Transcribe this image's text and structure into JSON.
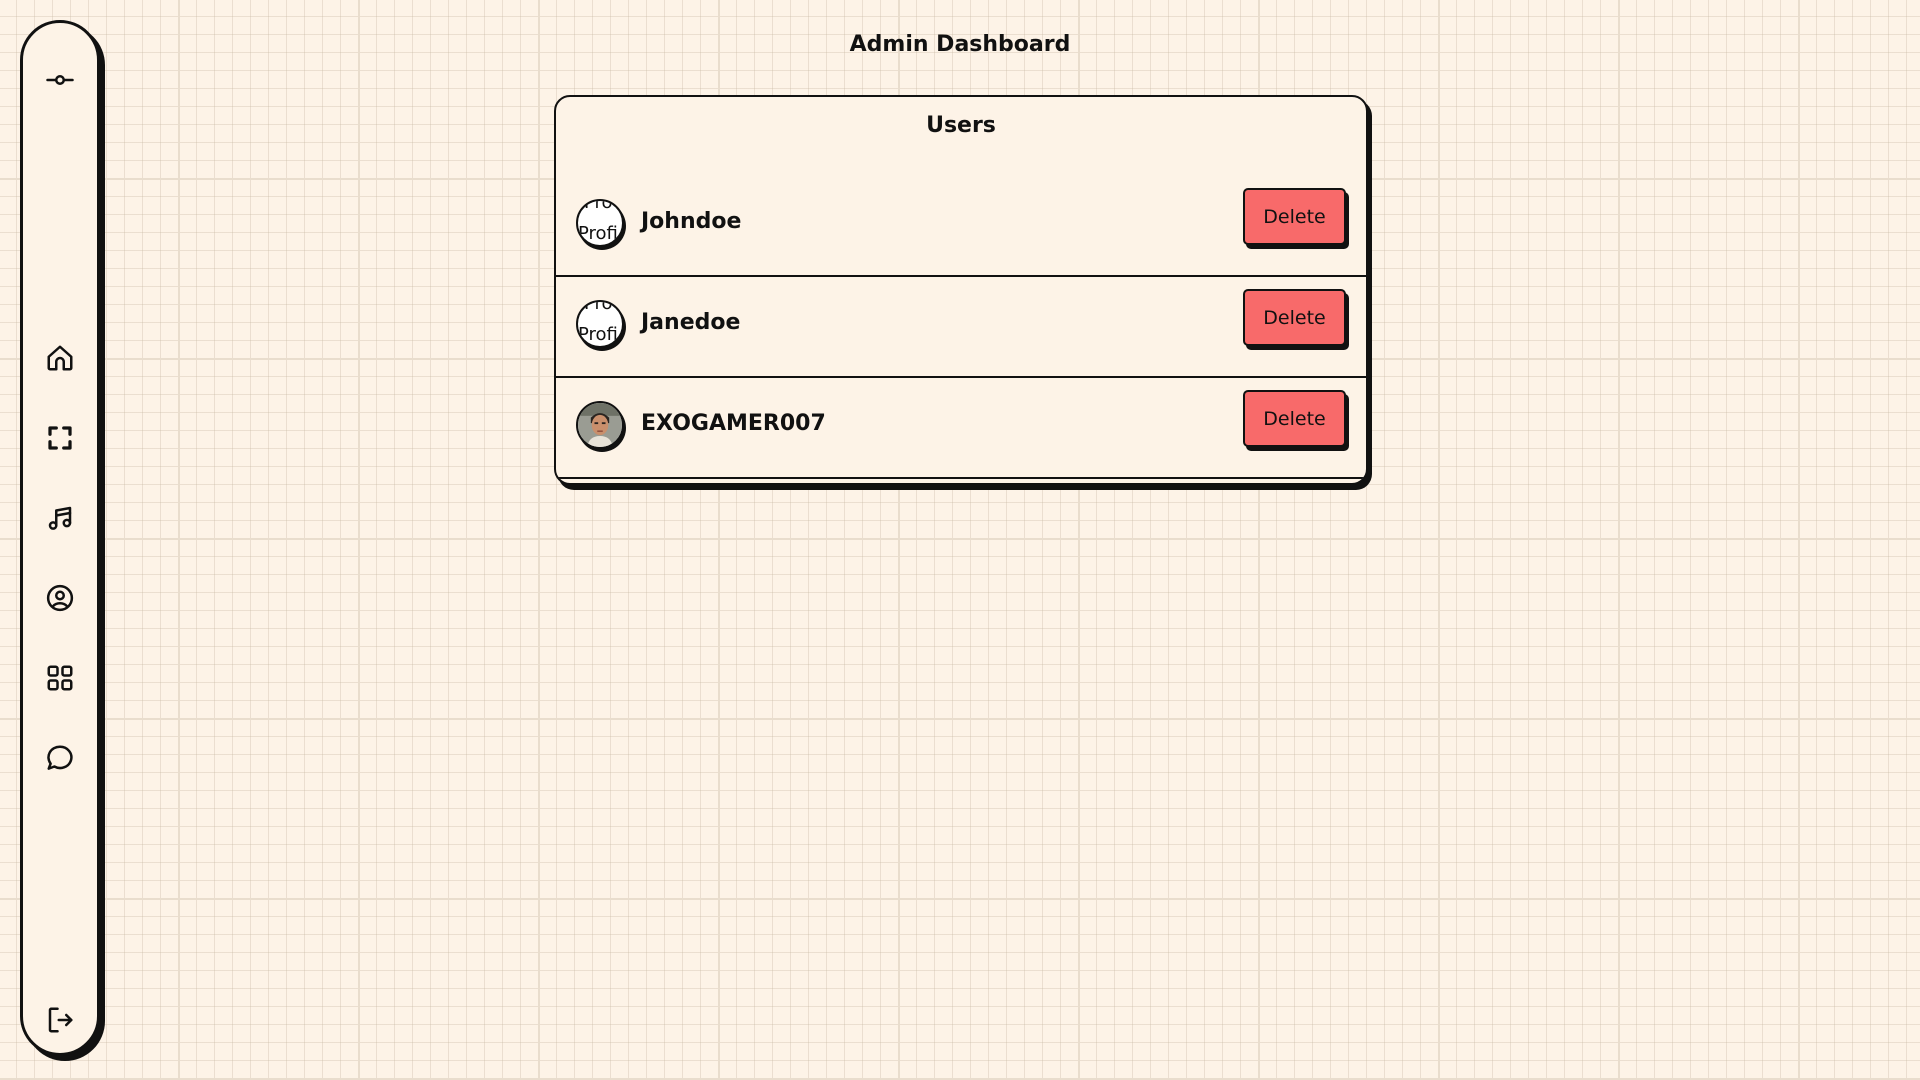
{
  "header": {
    "title": "Admin Dashboard"
  },
  "sidebar": {
    "items": [
      {
        "icon": "commit-icon"
      },
      {
        "icon": "home-icon"
      },
      {
        "icon": "scan-icon"
      },
      {
        "icon": "music-icon"
      },
      {
        "icon": "user-circle-icon"
      },
      {
        "icon": "grid-icon"
      },
      {
        "icon": "chat-icon"
      },
      {
        "icon": "logout-icon"
      }
    ]
  },
  "users_card": {
    "title": "Users",
    "users": [
      {
        "username": "Johndoe",
        "avatar_alt": "Profi",
        "delete_label": "Delete"
      },
      {
        "username": "Janedoe",
        "avatar_alt": "Profi",
        "delete_label": "Delete"
      },
      {
        "username": "EXOGAMER007",
        "avatar_alt": "",
        "delete_label": "Delete"
      }
    ]
  },
  "colors": {
    "background": "#fdf3e7",
    "grid": "#e9ddcd",
    "delete": "#f86a6a",
    "border": "#111111"
  }
}
